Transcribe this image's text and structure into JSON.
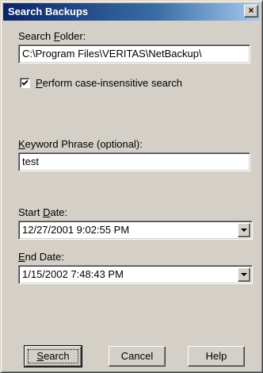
{
  "window": {
    "title": "Search Backups",
    "close_glyph": "×"
  },
  "search_folder": {
    "label_pre": "Search ",
    "label_key": "F",
    "label_post": "older:",
    "value": "C:\\Program Files\\VERITAS\\NetBackup\\"
  },
  "case_insensitive": {
    "label_key": "P",
    "label_post": "erform case-insensitive search",
    "checked": true
  },
  "keyword": {
    "label_key": "K",
    "label_post": "eyword Phrase (optional):",
    "value": "test"
  },
  "start_date": {
    "label_pre": "Start ",
    "label_key": "D",
    "label_post": "ate:",
    "value": "12/27/2001 9:02:55 PM"
  },
  "end_date": {
    "label_key": "E",
    "label_post": "nd Date:",
    "value": "1/15/2002 7:48:43 PM"
  },
  "buttons": {
    "search_key": "S",
    "search_post": "earch",
    "cancel": "Cancel",
    "help": "Help"
  },
  "colors": {
    "face": "#d4d0c8",
    "title_start": "#0a246a",
    "title_end": "#a6caf0"
  }
}
